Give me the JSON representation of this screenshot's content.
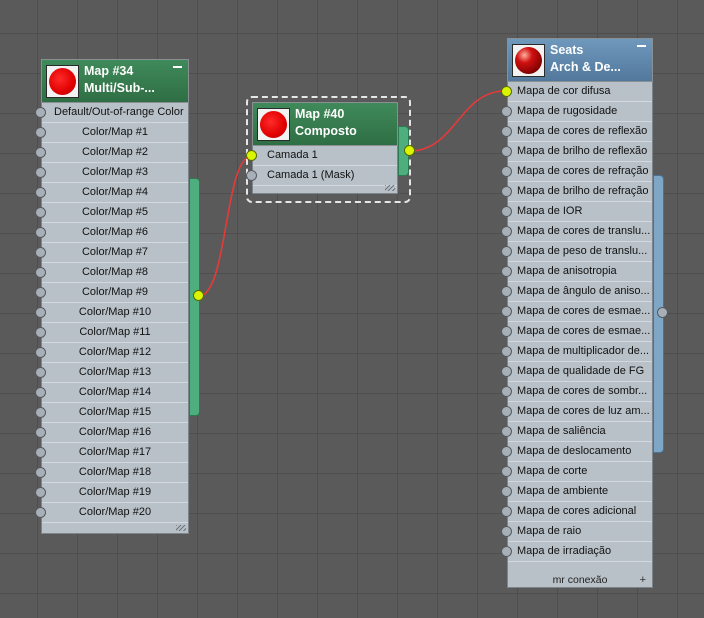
{
  "nodes": {
    "map34": {
      "title_line1": "Map #34",
      "title_line2": "Multi/Sub-...",
      "rows": [
        "Default/Out-of-range Color",
        "Color/Map #1",
        "Color/Map #2",
        "Color/Map #3",
        "Color/Map #4",
        "Color/Map #5",
        "Color/Map #6",
        "Color/Map #7",
        "Color/Map #8",
        "Color/Map #9",
        "Color/Map #10",
        "Color/Map #11",
        "Color/Map #12",
        "Color/Map #13",
        "Color/Map #14",
        "Color/Map #15",
        "Color/Map #16",
        "Color/Map #17",
        "Color/Map #18",
        "Color/Map #19",
        "Color/Map #20"
      ]
    },
    "map40": {
      "title_line1": "Map #40",
      "title_line2": "Composto",
      "rows": [
        "Camada 1",
        "Camada 1 (Mask)"
      ]
    },
    "seats": {
      "title_line1": "Seats",
      "title_line2": "Arch & De...",
      "rows": [
        "Mapa de cor difusa",
        "Mapa de rugosidade",
        "Mapa de cores de reflexão",
        "Mapa de brilho de reflexão",
        "Mapa de cores de refração",
        "Mapa de brilho de refração",
        "Mapa de IOR",
        "Mapa de cores de translu...",
        "Mapa de peso de translu...",
        "Mapa de anisotropia",
        "Mapa de ângulo de aniso...",
        "Mapa de cores de esmae...",
        "Mapa de cores de esmae...",
        "Mapa de multiplicador de...",
        "Mapa de qualidade de FG",
        "Mapa de cores de sombr...",
        "Mapa de cores de luz am...",
        "Mapa de saliência",
        "Mapa de deslocamento",
        "Mapa de corte",
        "Mapa de ambiente",
        "Mapa de cores adicional",
        "Mapa de raio",
        "Mapa de irradiação"
      ],
      "footer": "mr conexão"
    }
  },
  "icons": {
    "map34": "red-sphere-icon",
    "map40": "red-sphere-icon",
    "seats": "shaded-sphere-icon"
  },
  "colors": {
    "green_header": "#2f6e44",
    "blue_header": "#52799c",
    "wire": "#e63a3a",
    "active_socket": "#d9f500"
  }
}
